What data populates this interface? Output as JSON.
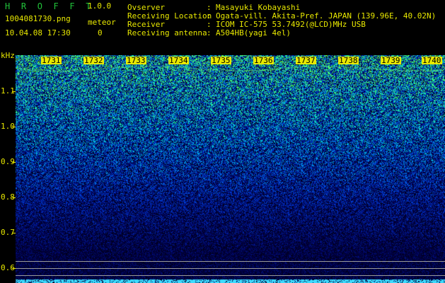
{
  "app": {
    "title": "H R O F F T",
    "version": "1.0.0",
    "filename": "1004081730.png",
    "datetime": "10.04.08 17:30",
    "meteor_label": "meteor",
    "meteor_count": "0"
  },
  "info": [
    {
      "label": "Ovserver",
      "value": "Masayuki Kobayashi"
    },
    {
      "label": "Receiving Location",
      "value": "Ogata-vill. Akita-Pref. JAPAN (139.96E, 40.02N)"
    },
    {
      "label": "Receiver",
      "value": "ICOM IC-575 53.7492(@LCD)MHz USB"
    },
    {
      "label": "Receiving antenna",
      "value": "A504HB(yagi 4el)"
    }
  ],
  "info_separator": ":",
  "axis": {
    "unit": "kHz",
    "y_ticks": [
      "1.1",
      "1.0",
      "0.9",
      "0.8",
      "0.7",
      "0.6"
    ],
    "x_ticks": [
      "1731",
      "1732",
      "1733",
      "1734",
      "1735",
      "1736",
      "1737",
      "1738",
      "1739",
      "1740"
    ]
  },
  "colors": {
    "label_yellow": "#e8e800",
    "title_green": "#21c23a",
    "background": "#000000",
    "noise_dark": "#000040",
    "noise_blue": "#0030c0",
    "noise_cyan": "#00c0e0",
    "noise_green": "#40ff80"
  }
}
